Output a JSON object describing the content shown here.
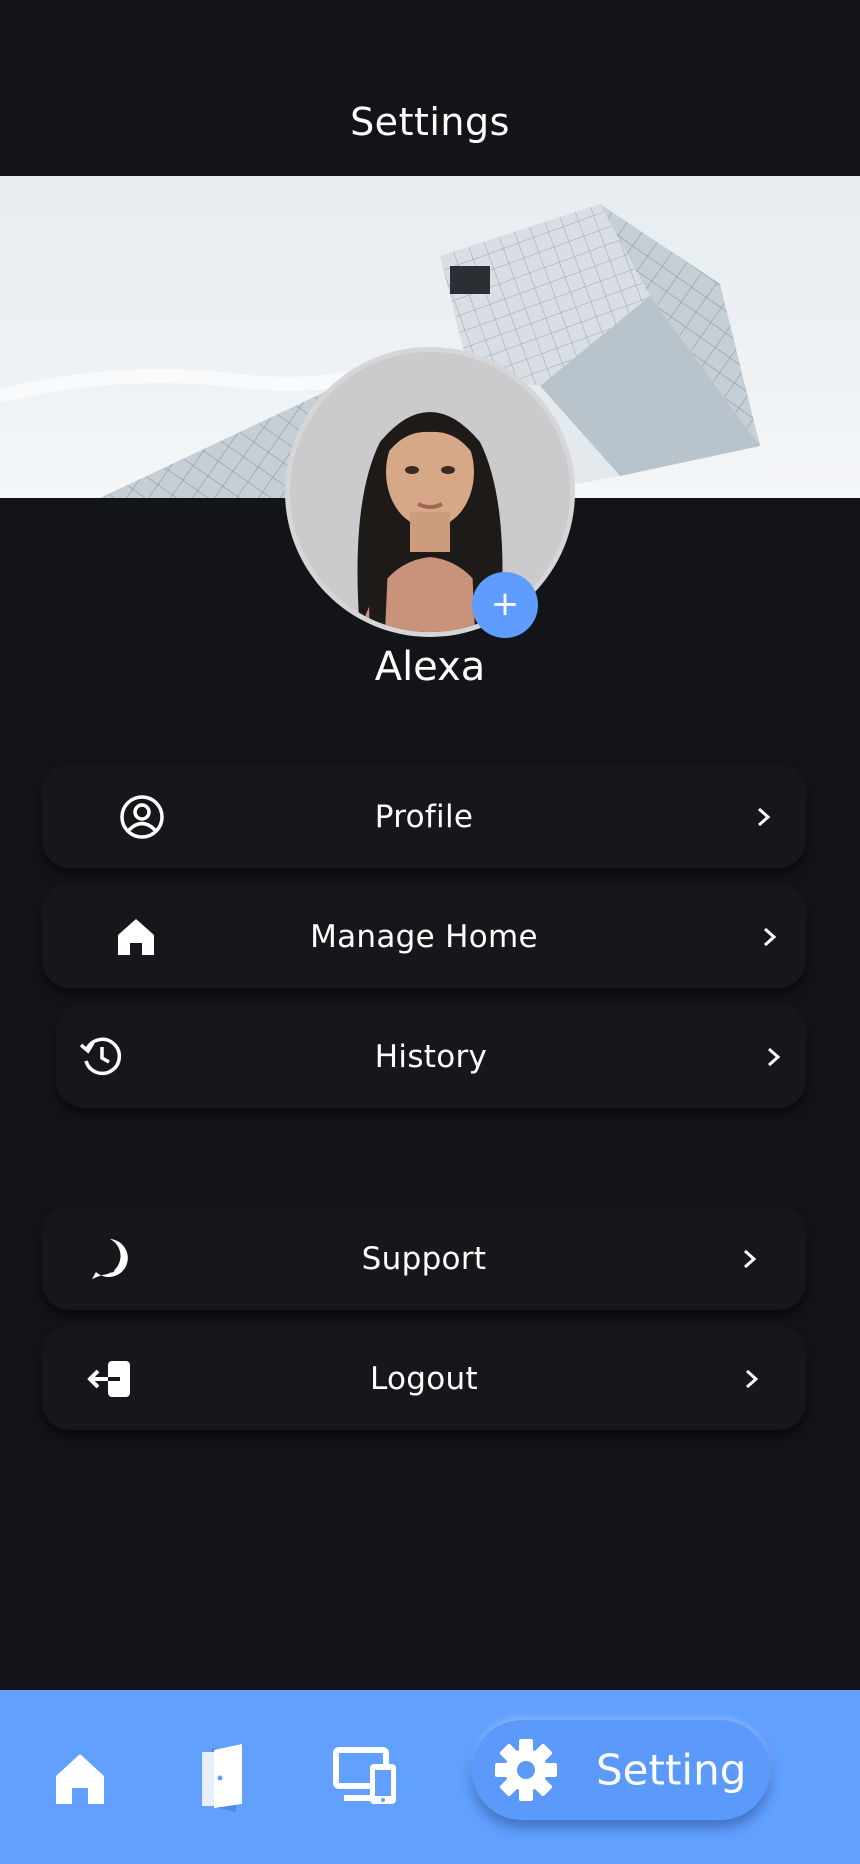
{
  "header": {
    "title": "Settings"
  },
  "profile": {
    "name": "Alexa",
    "add_photo_label": "+"
  },
  "menu": {
    "group1": [
      {
        "label": "Profile",
        "icon": "user-circle-icon"
      },
      {
        "label": "Manage Home",
        "icon": "home-icon"
      },
      {
        "label": "History",
        "icon": "history-icon"
      }
    ],
    "group2": [
      {
        "label": "Support",
        "icon": "help-icon"
      },
      {
        "label": "Logout",
        "icon": "logout-icon"
      }
    ]
  },
  "bottom_nav": {
    "items": [
      {
        "icon": "home-icon"
      },
      {
        "icon": "door-icon"
      },
      {
        "icon": "devices-icon"
      },
      {
        "icon": "gear-icon",
        "label": "Setting",
        "active": true
      }
    ]
  },
  "colors": {
    "background": "#131417",
    "accent": "#62a0ff",
    "card": "#16171a"
  }
}
